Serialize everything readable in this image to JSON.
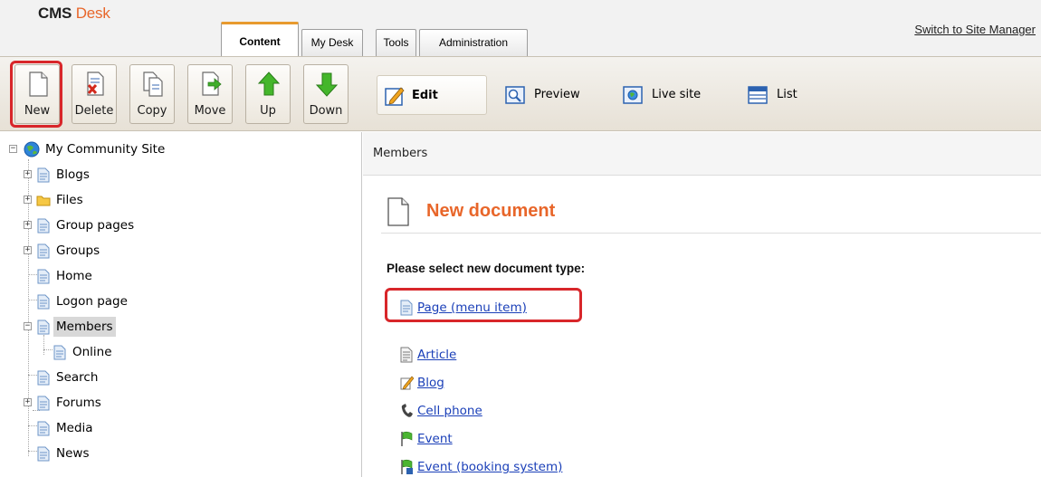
{
  "header": {
    "logo_cms": "CMS",
    "logo_desk": "Desk",
    "tabs": [
      {
        "label": "Content",
        "active": true
      },
      {
        "label": "My Desk",
        "active": false
      },
      {
        "label": "Tools",
        "active": false
      },
      {
        "label": "Administration",
        "active": false
      }
    ],
    "switch_link": "Switch to Site Manager"
  },
  "toolbar": {
    "buttons": [
      {
        "label": "New",
        "icon": "new-document-icon",
        "highlighted": true
      },
      {
        "label": "Delete",
        "icon": "delete-document-icon"
      },
      {
        "label": "Copy",
        "icon": "copy-document-icon"
      },
      {
        "label": "Move",
        "icon": "move-document-icon"
      },
      {
        "label": "Up",
        "icon": "up-arrow-icon"
      },
      {
        "label": "Down",
        "icon": "down-arrow-icon"
      }
    ]
  },
  "view_modes": [
    {
      "label": "Edit",
      "icon": "edit-pencil-icon",
      "active": true
    },
    {
      "label": "Preview",
      "icon": "preview-magnifier-icon",
      "active": false
    },
    {
      "label": "Live site",
      "icon": "live-site-globe-icon",
      "active": false
    },
    {
      "label": "List",
      "icon": "list-icon",
      "active": false
    }
  ],
  "tree": {
    "root": "My Community Site",
    "items": [
      {
        "label": "Blogs",
        "icon": "page-icon",
        "expandable": true
      },
      {
        "label": "Files",
        "icon": "folder-icon",
        "expandable": true
      },
      {
        "label": "Group pages",
        "icon": "page-icon",
        "expandable": true
      },
      {
        "label": "Groups",
        "icon": "page-icon",
        "expandable": true
      },
      {
        "label": "Home",
        "icon": "page-icon",
        "expandable": false
      },
      {
        "label": "Logon page",
        "icon": "page-icon",
        "expandable": false
      },
      {
        "label": "Members",
        "icon": "page-icon",
        "expandable": true,
        "expanded": true,
        "selected": true
      },
      {
        "label": "Online",
        "icon": "page-icon",
        "expandable": false,
        "child": true
      },
      {
        "label": "Search",
        "icon": "page-icon",
        "expandable": false
      },
      {
        "label": "Forums",
        "icon": "page-icon",
        "expandable": true
      },
      {
        "label": "Media",
        "icon": "page-icon",
        "expandable": false
      },
      {
        "label": "News",
        "icon": "page-icon",
        "expandable": false
      }
    ]
  },
  "content": {
    "breadcrumb": "Members",
    "title": "New document",
    "prompt": "Please select new document type:",
    "doc_types": [
      {
        "label": "Page (menu item)",
        "icon": "page-icon",
        "highlighted": true
      },
      {
        "label": "Article",
        "icon": "article-icon"
      },
      {
        "label": "Blog",
        "icon": "blog-icon"
      },
      {
        "label": "Cell phone",
        "icon": "cell-phone-icon"
      },
      {
        "label": "Event",
        "icon": "event-flag-icon"
      },
      {
        "label": "Event (booking system)",
        "icon": "event-booking-icon"
      }
    ]
  },
  "colors": {
    "accent_orange": "#e8662a",
    "highlight_red": "#d8262a",
    "link_blue": "#1a3fb8",
    "tab_accent": "#e89a2e"
  }
}
